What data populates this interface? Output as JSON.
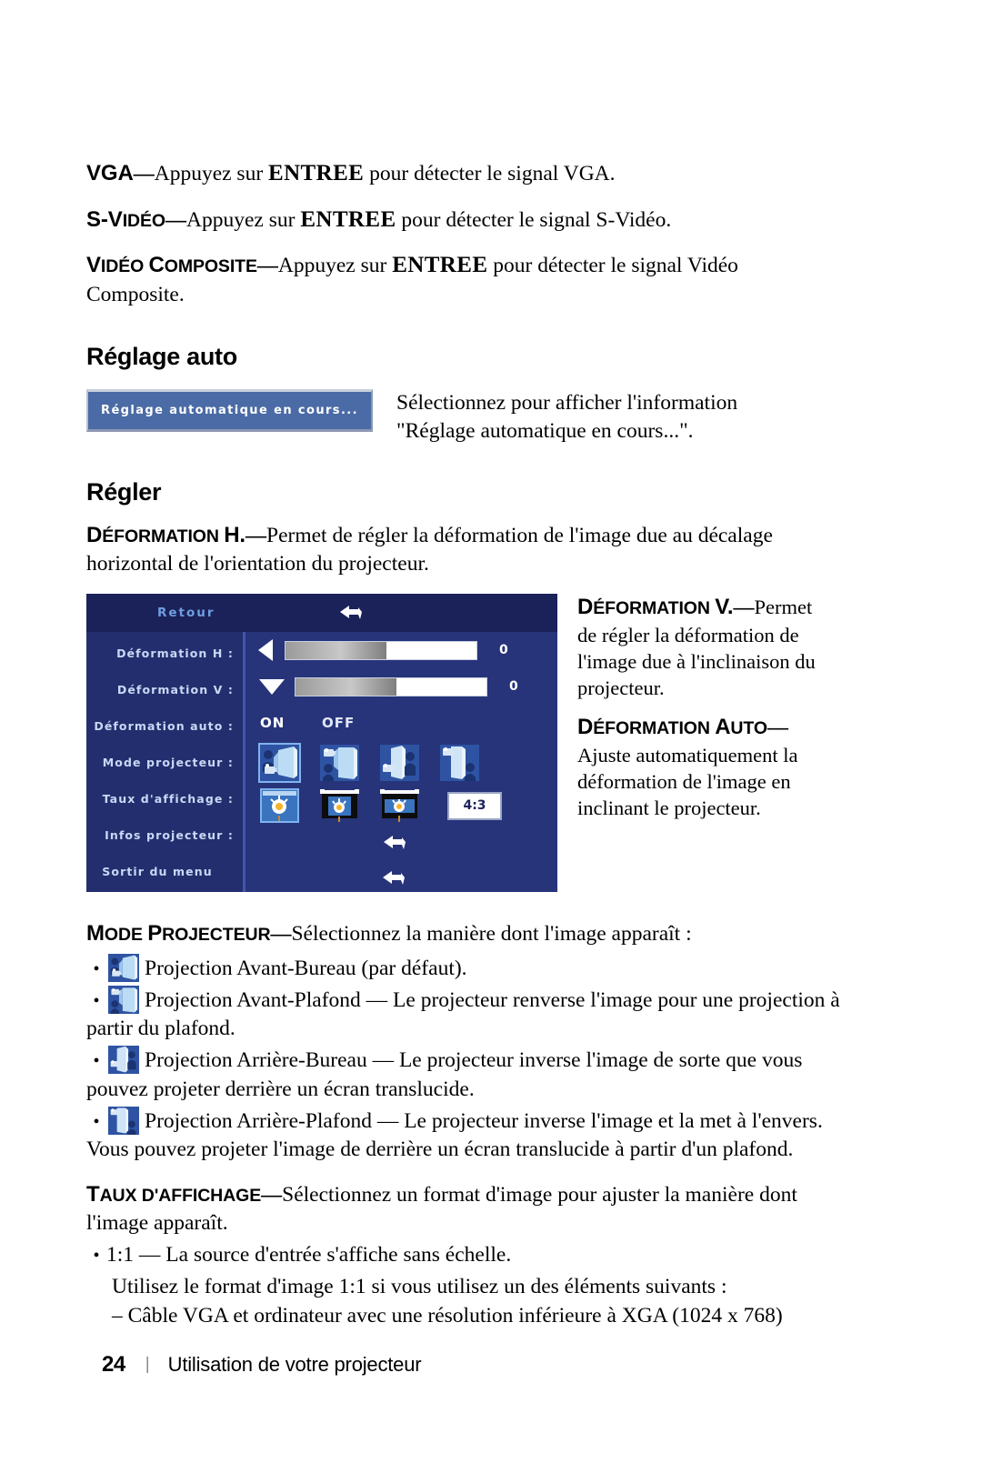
{
  "document": {
    "intro_items": [
      {
        "term_cap": "VGA",
        "term_rest": "",
        "dash": "—",
        "before_key": "Appuyez sur ",
        "key": "ENTREE",
        "after_key": " pour détecter le signal VGA."
      },
      {
        "term_cap": "S-V",
        "term_rest": "IDÉO",
        "dash": "—",
        "before_key": "Appuyez sur ",
        "key": "ENTREE",
        "after_key": " pour détecter le signal S-Vidéo."
      },
      {
        "term_cap": "V",
        "term_rest": "IDÉO ",
        "term_cap2": "C",
        "term_rest2": "OMPOSITE",
        "dash": "—",
        "before_key": "Appuyez sur ",
        "key": "ENTREE",
        "after_key": " pour détecter le signal Vidéo Composite."
      }
    ],
    "auto_adjust": {
      "heading": "Réglage auto",
      "button_label": "Réglage automatique en cours...",
      "description_line1": "Sélectionnez pour afficher l'information",
      "description_line2": "\"Réglage automatique en cours...\"."
    },
    "adjust": {
      "heading": "Régler",
      "keystone_h": {
        "term_cap": "D",
        "term_rest": "ÉFORMATION ",
        "term_cap2": "H.",
        "dash": "—",
        "body": "Permet de régler la déformation de l'image due au décalage horizontal de l'orientation du projecteur."
      },
      "keystone_v": {
        "term_cap": "D",
        "term_rest": "ÉFORMATION ",
        "term_cap2": "V.",
        "dash": "—",
        "body": "Permet de régler la déformation de l'image due à l'inclinaison du projecteur."
      },
      "keystone_auto": {
        "term_cap": "D",
        "term_rest": "ÉFORMATION ",
        "term_cap2": "A",
        "term_rest2": "UTO",
        "dash": "—",
        "body": "Ajuste automatiquement la déformation de l'image en inclinant le projecteur."
      }
    },
    "osd": {
      "title": "Retour",
      "back_arrow_icon": "back-arrow-icon",
      "rows": [
        {
          "label": "Déformation H :",
          "value": "0",
          "control": "slider",
          "arrow": "left"
        },
        {
          "label": "Déformation V :",
          "value": "0",
          "control": "slider",
          "arrow": "down"
        },
        {
          "label": "Déformation auto :",
          "on": "ON",
          "off": "OFF",
          "control": "onoff"
        },
        {
          "label": "Mode projecteur :",
          "control": "projector-modes"
        },
        {
          "label": "Taux d'affichage :",
          "control": "aspect-ratios",
          "ratio_label": "4:3"
        },
        {
          "label": "Infos projecteur :",
          "control": "arrow"
        },
        {
          "label": "Sortir du menu",
          "control": "arrow"
        }
      ],
      "projector_mode_icons": [
        "front-desktop-icon",
        "front-ceiling-icon",
        "rear-desktop-icon",
        "rear-ceiling-icon"
      ],
      "aspect_icons": [
        "aspect-fill-icon",
        "aspect-letterbox-icon",
        "aspect-widescreen-icon"
      ]
    },
    "projector_mode": {
      "term_cap": "M",
      "term_rest": "ODE ",
      "term_cap2": "P",
      "term_rest2": "ROJECTEUR",
      "dash": "—",
      "body": "Sélectionnez la manière dont l'image apparaît :",
      "items": [
        {
          "icon": "front-desktop-icon",
          "text": "Projection Avant-Bureau (par défaut)."
        },
        {
          "icon": "front-ceiling-icon",
          "text": "Projection Avant-Plafond — Le projecteur renverse l'image pour une projection à partir du plafond."
        },
        {
          "icon": "rear-desktop-icon",
          "text": "Projection Arrière-Bureau — Le projecteur inverse l'image de sorte que vous pouvez projeter derrière un écran translucide."
        },
        {
          "icon": "rear-ceiling-icon",
          "text": "Projection Arrière-Plafond — Le projecteur inverse l'image et la met à l'envers. Vous pouvez projeter l'image de derrière un écran translucide à partir d'un plafond."
        }
      ]
    },
    "aspect_ratio": {
      "term_cap": "T",
      "term_rest": "AUX D'AFFICHAGE",
      "dash": "—",
      "body": "Sélectionnez un format d'image pour ajuster la manière dont l'image apparaît.",
      "bullet_1": "1:1 — La source d'entrée s'affiche sans échelle.",
      "note": "Utilisez le format d'image 1:1 si vous utilisez un des éléments suivants :",
      "subitem": "– Câble VGA et ordinateur avec une résolution inférieure à XGA (1024 x 768)"
    },
    "footer": {
      "page_number": "24",
      "separator": "|",
      "title": "Utilisation de votre projecteur"
    },
    "colors": {
      "osd_bg": "#27347a",
      "osd_title_bg": "#1b2259",
      "osd_label": "#1f3f8f",
      "osd_label_highlight": "#c9d8f5",
      "button_blue": "#4a6ba5",
      "icon_blue": "#2f53a3"
    }
  }
}
